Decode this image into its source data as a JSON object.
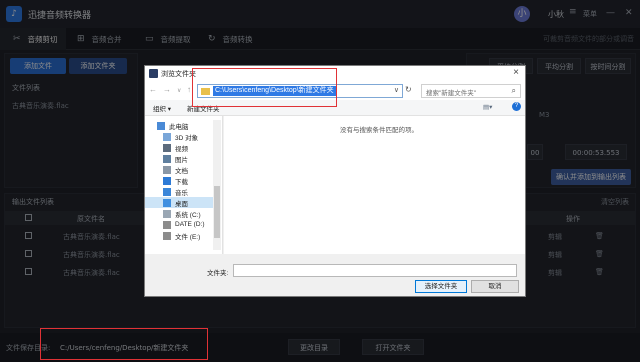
{
  "app": {
    "title": "迅捷音频转换器",
    "user_name": "小秋",
    "menu_label": "菜单",
    "avatar_initial": "小"
  },
  "tabs": [
    {
      "label": "音频剪切",
      "icon": "scissors-icon",
      "active": true
    },
    {
      "label": "音频合并",
      "icon": "merge-icon",
      "active": false
    },
    {
      "label": "音频提取",
      "icon": "extract-icon",
      "active": false
    },
    {
      "label": "音频转换",
      "icon": "convert-icon",
      "active": false
    }
  ],
  "tab_hint": "可裁剪音频文件的部分或调音",
  "left_panel": {
    "add_file": "添加文件",
    "add_folder": "添加文件夹",
    "file_list_label": "文件列表",
    "file_item": "古典音乐演奏.flac"
  },
  "right_panel": {
    "split_modes": [
      "平均分割",
      "平均分割",
      "按时间分割"
    ],
    "format_value": "M3",
    "time_end": "00:00:53.553",
    "time_start": "00",
    "confirm_button": "确认并添加到输出列表"
  },
  "output": {
    "label": "输出文件列表",
    "clear_label": "清空列表",
    "col_name": "原文件名",
    "col_op": "操作",
    "rows": [
      {
        "name": "古典音乐演奏.flac",
        "op": "剪辑"
      },
      {
        "name": "古典音乐演奏.flac",
        "op": "剪辑"
      },
      {
        "name": "古典音乐演奏.flac",
        "op": "剪辑"
      }
    ]
  },
  "bottom": {
    "save_label": "文件保存目录:",
    "save_path": "C:/Users/cenfeng/Desktop/新建文件夹",
    "change_dir": "更改目录",
    "open_folder": "打开文件夹"
  },
  "dialog": {
    "title": "浏览文件夹",
    "address_path": "C:\\Users\\cenfeng\\Desktop\\新建文件夹",
    "search_placeholder": "搜索\"新建文件夹\"",
    "organize": "组织 ▾",
    "new_folder": "新建文件夹",
    "tree": [
      {
        "label": "此电脑",
        "icon": "computer-icon",
        "selected": false
      },
      {
        "label": "3D 对象",
        "icon": "cube-icon",
        "selected": false
      },
      {
        "label": "视频",
        "icon": "video-icon",
        "selected": false
      },
      {
        "label": "图片",
        "icon": "picture-icon",
        "selected": false
      },
      {
        "label": "文档",
        "icon": "document-icon",
        "selected": false
      },
      {
        "label": "下载",
        "icon": "download-icon",
        "selected": false
      },
      {
        "label": "音乐",
        "icon": "music-icon",
        "selected": false
      },
      {
        "label": "桌面",
        "icon": "desktop-icon",
        "selected": true
      },
      {
        "label": "系统 (C:)",
        "icon": "drive-icon",
        "selected": false
      },
      {
        "label": "DATE (D:)",
        "icon": "drive-icon",
        "selected": false
      },
      {
        "label": "文件 (E:)",
        "icon": "drive-icon",
        "selected": false
      }
    ],
    "empty_message": "没有与搜索条件匹配的项。",
    "folder_label": "文件夹:",
    "select_button": "选择文件夹",
    "cancel_button": "取消"
  },
  "colors": {
    "accent": "#2b6fd6",
    "highlight_box": "#e03236"
  }
}
